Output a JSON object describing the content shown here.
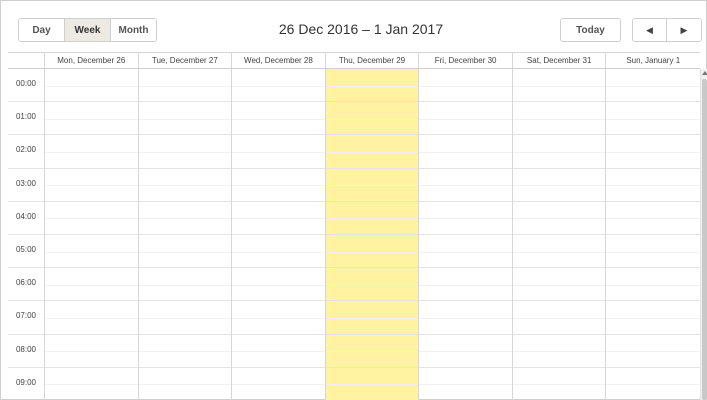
{
  "toolbar": {
    "views": [
      {
        "label": "Day",
        "active": false
      },
      {
        "label": "Week",
        "active": true
      },
      {
        "label": "Month",
        "active": false
      }
    ],
    "range_title": "26 Dec 2016 – 1 Jan 2017",
    "today_label": "Today",
    "prev_icon": "◀",
    "next_icon": "▶"
  },
  "days": [
    {
      "label": "Mon, December 26",
      "today": false
    },
    {
      "label": "Tue, December 27",
      "today": false
    },
    {
      "label": "Wed, December 28",
      "today": false
    },
    {
      "label": "Thu, December 29",
      "today": true
    },
    {
      "label": "Fri, December 30",
      "today": false
    },
    {
      "label": "Sat, December 31",
      "today": false
    },
    {
      "label": "Sun, January 1",
      "today": false
    }
  ],
  "hours": [
    "00:00",
    "01:00",
    "02:00",
    "03:00",
    "04:00",
    "05:00",
    "06:00",
    "07:00",
    "08:00",
    "09:00"
  ],
  "colors": {
    "today_highlight": "#fff3a1",
    "active_view": "#ede9e3",
    "grid_line": "#d6d6d6"
  }
}
